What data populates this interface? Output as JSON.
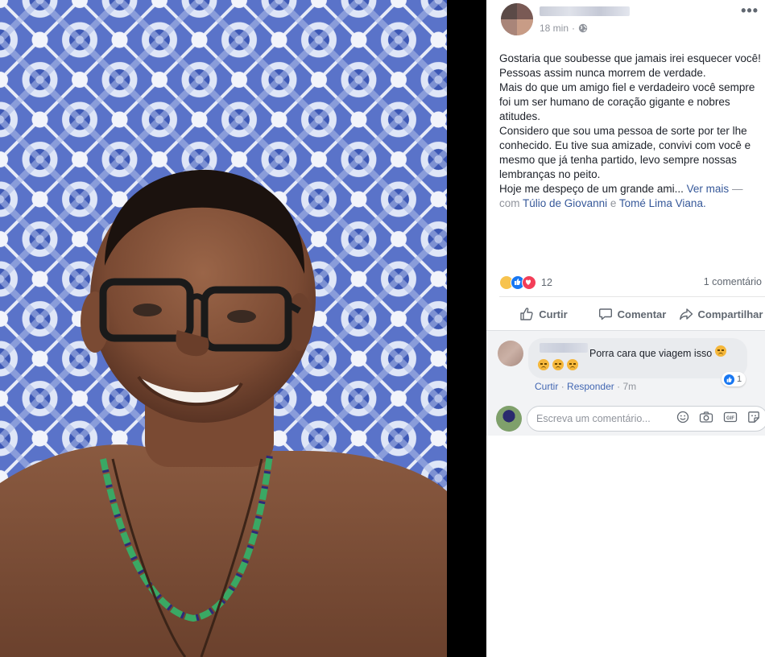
{
  "post": {
    "time": "18 min",
    "separator": "·",
    "more": "•••",
    "paragraphs": [
      "Gostaria que soubesse que jamais irei esquecer você! Pessoas assim nunca morrem de verdade.",
      "Mais do que um amigo fiel e verdadeiro você sempre foi um ser humano de coração gigante e nobres atitudes.",
      "Considero que sou uma pessoa de sorte por ter lhe conhecido. Eu tive sua amizade, convivi com você e mesmo que já tenha partido, levo sempre nossas lembranças no peito."
    ],
    "truncated_line": "Hoje me despeço de um grande ami...",
    "see_more": "Ver mais",
    "dash": "—",
    "with_prefix": "com",
    "tag1": "Túlio de Giovanni",
    "and": "e",
    "tag2": "Tomé Lima Viana",
    "period": "."
  },
  "stats": {
    "reactions_count": "12",
    "comments": "1 comentário"
  },
  "actions": {
    "like": "Curtir",
    "comment": "Comentar",
    "share": "Compartilhar"
  },
  "comment": {
    "text": "Porra cara que viagem isso",
    "like_count": "1",
    "like_label": "Curtir",
    "reply_label": "Responder",
    "sep": "·",
    "time": "7m"
  },
  "composer": {
    "placeholder": "Escreva um comentário..."
  },
  "icons": [
    "globe-icon",
    "like-icon",
    "comment-icon",
    "share-icon",
    "emoji-icon",
    "camera-icon",
    "gif-icon",
    "sticker-icon"
  ],
  "colors": {
    "link": "#365899",
    "muted": "#90949c",
    "like_blue": "#1877f2",
    "tile_blue": "#3f5bb8"
  }
}
